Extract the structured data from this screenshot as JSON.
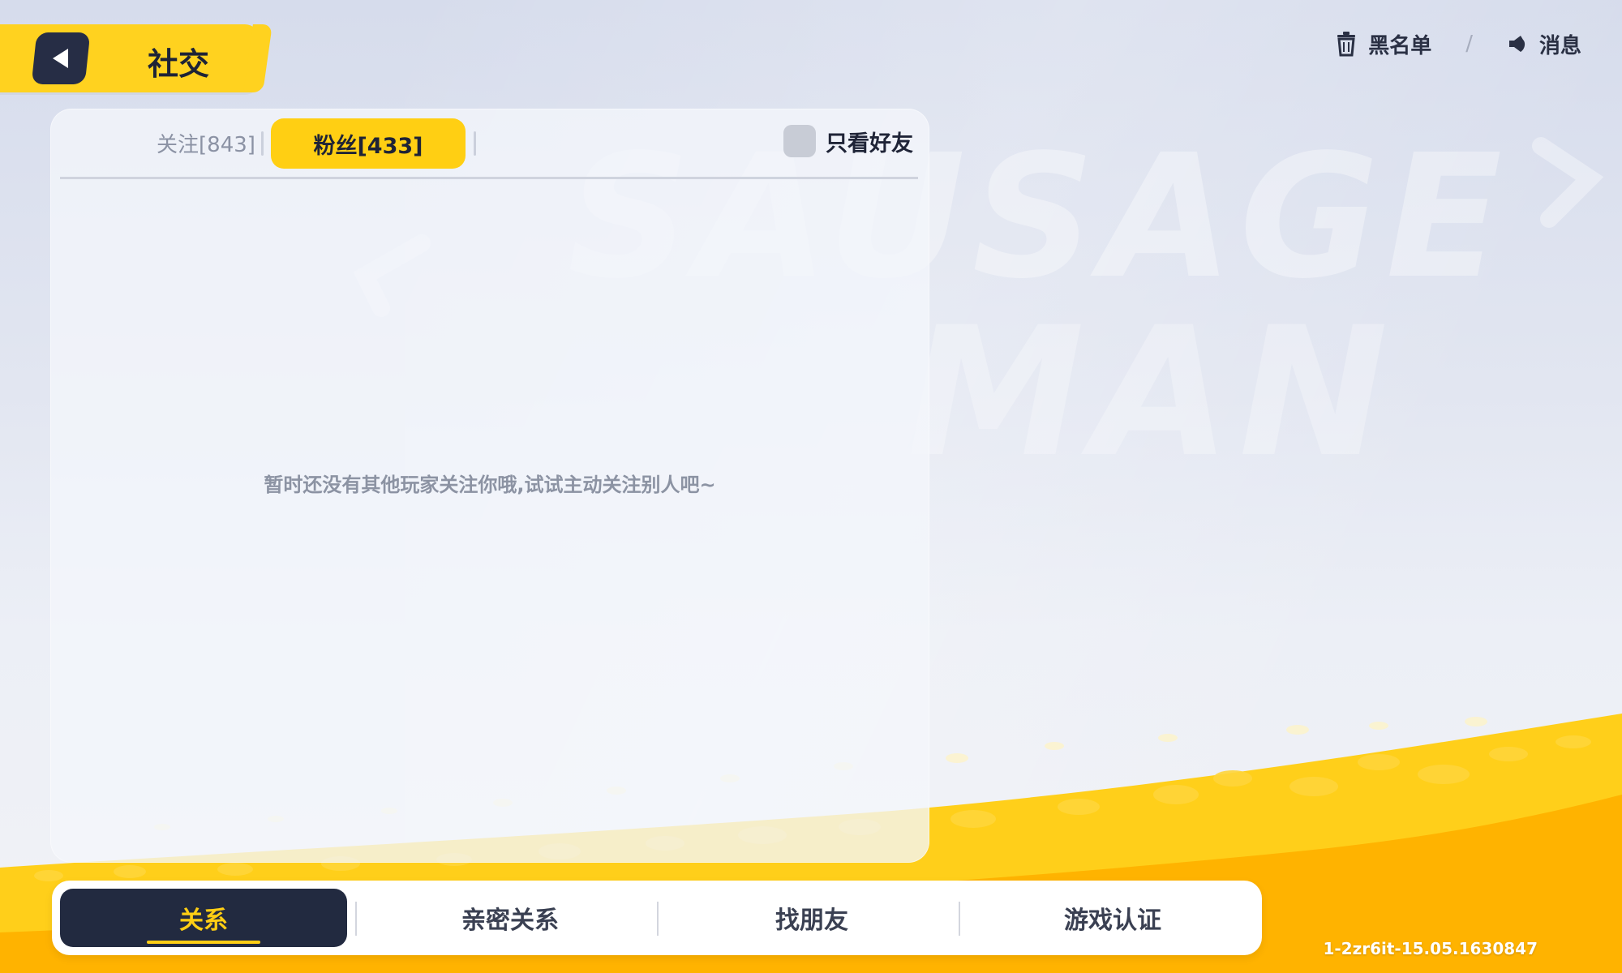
{
  "header": {
    "title": "社交",
    "back_icon": "back-arrow-icon"
  },
  "top_right": {
    "blacklist_label": "黑名单",
    "blacklist_icon": "trash-icon",
    "divider": "/",
    "messages_label": "消息",
    "messages_icon": "speaker-icon"
  },
  "panel": {
    "tabs": [
      {
        "label": "关注[843]",
        "active": false
      },
      {
        "label": "粉丝[433]",
        "active": true
      }
    ],
    "friends_only_label": "只看好友",
    "friends_only_checked": false,
    "empty_message": "暂时还没有其他玩家关注你哦,试试主动关注别人吧~"
  },
  "bottom_nav": {
    "tabs": [
      {
        "label": "关系",
        "active": true
      },
      {
        "label": "亲密关系",
        "active": false
      },
      {
        "label": "找朋友",
        "active": false
      },
      {
        "label": "游戏认证",
        "active": false
      }
    ]
  },
  "background": {
    "watermark_line1": "SAUSAGE",
    "watermark_line2": "MAN"
  },
  "version": "1-2zr6it-15.05.1630847",
  "colors": {
    "accent_yellow": "#ffcf13",
    "dark_navy": "#222a40",
    "muted_text": "#8c93a3"
  }
}
